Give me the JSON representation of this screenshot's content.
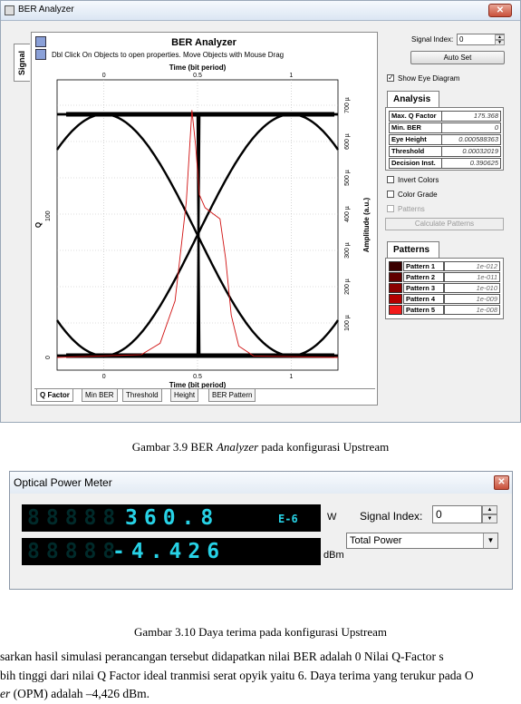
{
  "ber_window": {
    "title": "BER Analyzer",
    "side_tab": "Signal",
    "plot_title": "BER Analyzer",
    "plot_subtitle": "Dbl Click On Objects to open properties.  Move Objects with Mouse Drag",
    "x_axis_title_top": "Time (bit period)",
    "x_axis_title_bottom": "Time (bit period)",
    "left_axis_title": "Q",
    "right_axis_title": "Amplitude (a.u.)",
    "bottom_tabs": [
      "Q Factor",
      "Min BER",
      "Threshold",
      "Height",
      "BER Pattern"
    ],
    "signal_index_label": "Signal Index:",
    "signal_index_value": "0",
    "autoset_label": "Auto Set",
    "show_eye_label": "Show Eye Diagram",
    "analysis_tab": "Analysis",
    "analysis": [
      {
        "key": "Max. Q Factor",
        "value": "175.368"
      },
      {
        "key": "Min. BER",
        "value": "0"
      },
      {
        "key": "Eye Height",
        "value": "0.000588363"
      },
      {
        "key": "Threshold",
        "value": "0.00032019"
      },
      {
        "key": "Decision Inst.",
        "value": "0.390625"
      }
    ],
    "invert_colors_label": "Invert Colors",
    "color_grade_label": "Color Grade",
    "patterns_check_label": "Patterns",
    "calculate_label": "Calculate Patterns",
    "patterns_tab": "Patterns",
    "patterns": [
      {
        "key": "Pattern 1",
        "value": "1e-012",
        "color": "#3a0000"
      },
      {
        "key": "Pattern 2",
        "value": "1e-011",
        "color": "#600000"
      },
      {
        "key": "Pattern 3",
        "value": "1e-010",
        "color": "#8a0000"
      },
      {
        "key": "Pattern 4",
        "value": "1e-009",
        "color": "#b40000"
      },
      {
        "key": "Pattern 5",
        "value": "1e-008",
        "color": "#f21a1a"
      }
    ]
  },
  "chart_data": {
    "type": "line",
    "x_ticks_top": [
      "0",
      "0.5",
      "1"
    ],
    "x_ticks_bottom": [
      "0",
      "0.5",
      "1"
    ],
    "left_ticks": [
      "0",
      "100"
    ],
    "right_ticks": [
      "100 µ",
      "200 µ",
      "300 µ",
      "400 µ",
      "500 µ",
      "600 µ",
      "700 µ"
    ],
    "xlim": [
      -0.25,
      1.25
    ],
    "ylim_right": [
      -3e-05,
      0.00077
    ],
    "series": [
      {
        "name": "",
        "color": "#000000",
        "role": "eye-diagram"
      },
      {
        "name": "",
        "color": "#d01010",
        "role": "q-factor",
        "x": [
          -0.25,
          0.2,
          0.3,
          0.38,
          0.44,
          0.47,
          0.49,
          0.51,
          0.54,
          0.58,
          0.62,
          0.65,
          0.68,
          0.72,
          0.8,
          1.25
        ],
        "y": [
          0,
          2,
          10,
          40,
          110,
          175,
          150,
          115,
          106,
          102,
          98,
          70,
          30,
          8,
          1,
          0
        ]
      }
    ]
  },
  "captions": {
    "fig39_prefix": "Gambar 3.9 BER ",
    "fig39_italic": "Analyzer",
    "fig39_suffix": " pada konfigurasi Upstream",
    "fig310": "Gambar 3.10 Daya terima pada konfigurasi Upstream"
  },
  "opm_window": {
    "title": "Optical Power Meter",
    "power_w_digits": "360.8",
    "power_w_exp": "E-6",
    "power_w_unit": "W",
    "power_dbm_digits": "-4.426",
    "power_dbm_unit": "dBm",
    "signal_index_label": "Signal Index:",
    "signal_index_value": "0",
    "select_value": "Total Power"
  },
  "paragraph": {
    "line1": "sarkan hasil simulasi perancangan tersebut didapatkan nilai BER adalah 0 Nilai Q-Factor s",
    "line2": "bih tinggi dari nilai Q Factor ideal tranmisi serat opyik yaitu 6. Daya terima yang terukur pada O",
    "line3_italic": "er",
    "line3_rest": " (OPM) adalah –4,426 dBm."
  }
}
